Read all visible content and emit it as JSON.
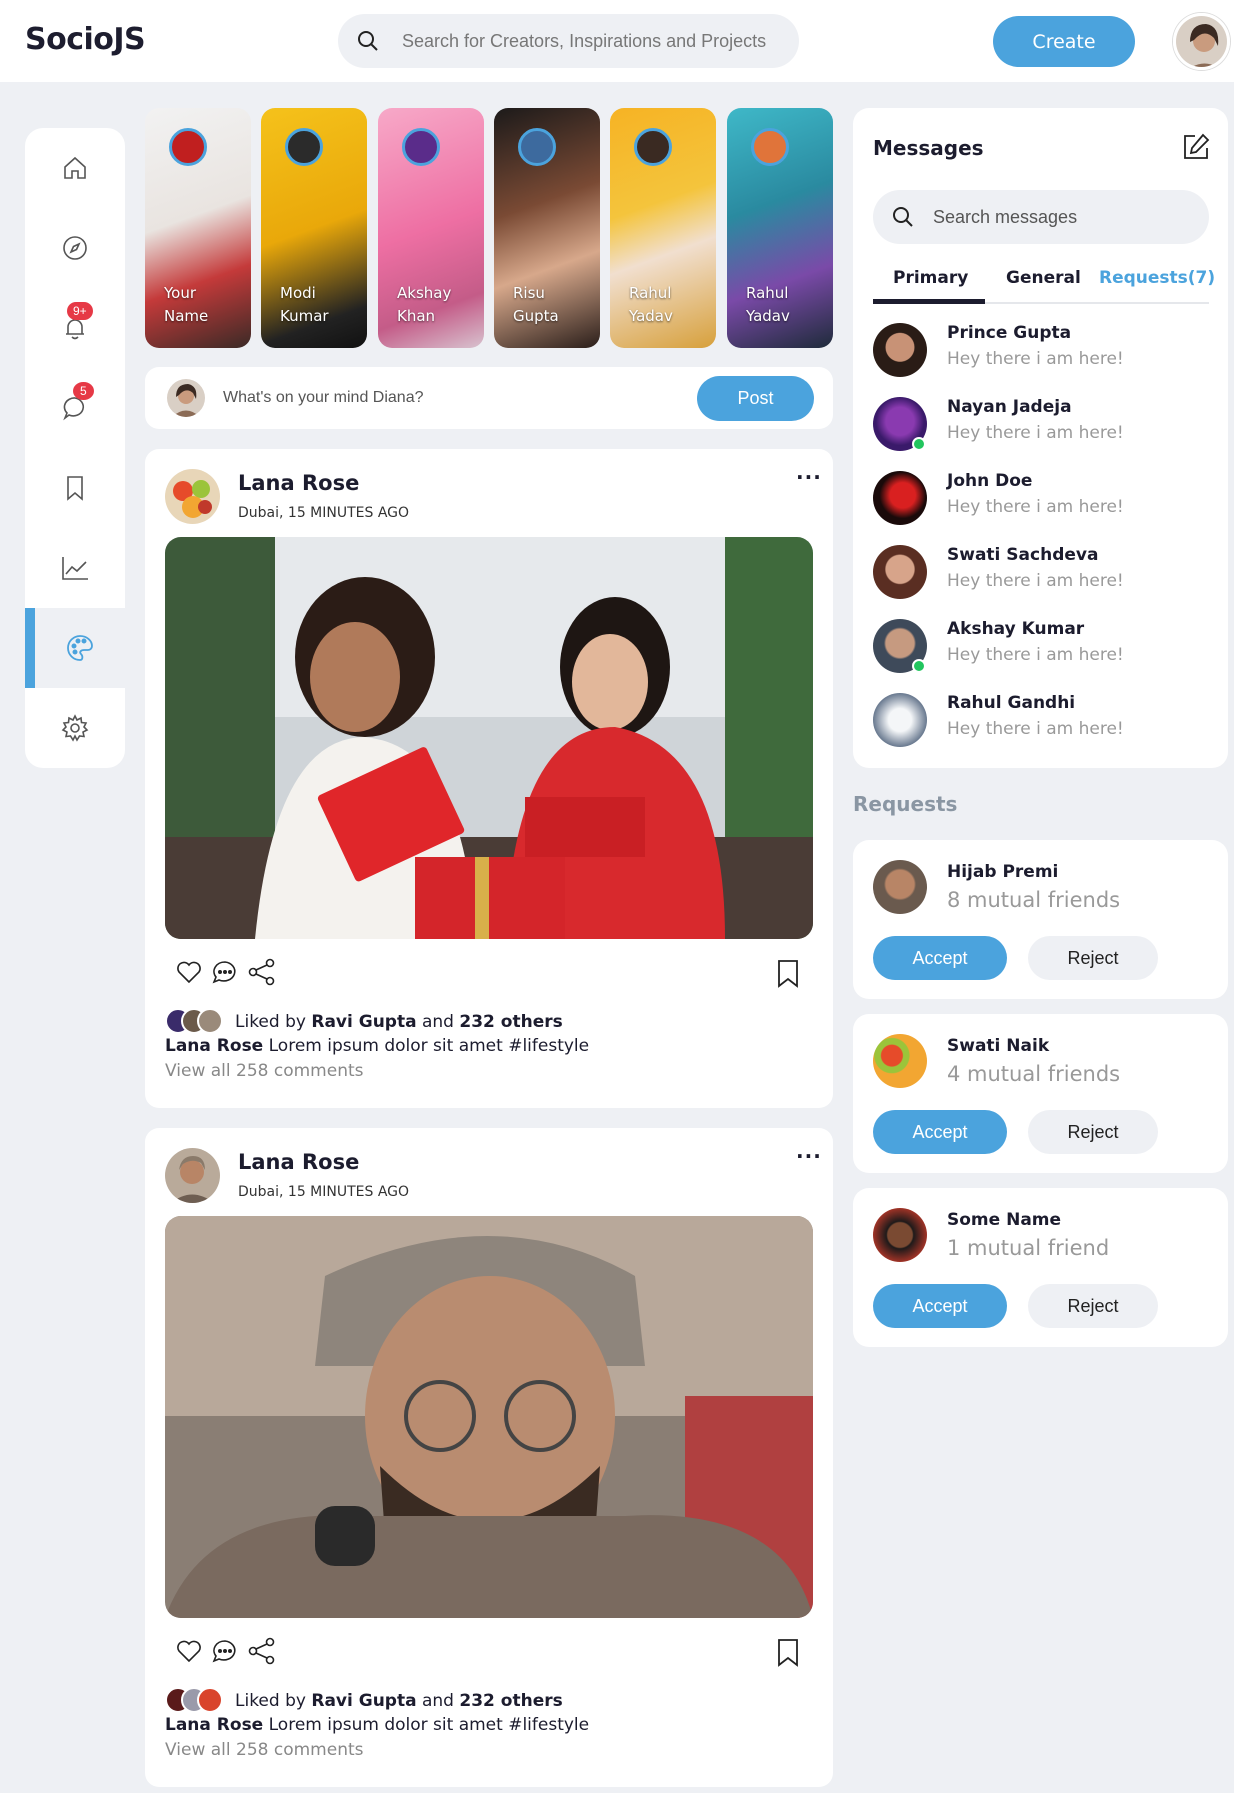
{
  "app": {
    "logo": "SocioJS"
  },
  "header": {
    "search_placeholder": "Search for Creators, Inspirations and Projects",
    "create_label": "Create"
  },
  "sidebar": {
    "items": [
      {
        "icon": "home-icon"
      },
      {
        "icon": "explore-icon"
      },
      {
        "icon": "notifications-icon",
        "badge": "9+"
      },
      {
        "icon": "messages-icon",
        "badge": "5"
      },
      {
        "icon": "bookmarks-icon"
      },
      {
        "icon": "analytics-icon"
      },
      {
        "icon": "theme-icon",
        "active": true
      },
      {
        "icon": "settings-icon"
      }
    ]
  },
  "stories": [
    {
      "line1": "Your",
      "line2": "Name"
    },
    {
      "line1": "Modi",
      "line2": "Kumar"
    },
    {
      "line1": "Akshay",
      "line2": "Khan"
    },
    {
      "line1": "Risu",
      "line2": "Gupta"
    },
    {
      "line1": "Rahul",
      "line2": "Yadav"
    },
    {
      "line1": "Rahul",
      "line2": "Yadav"
    }
  ],
  "composer": {
    "placeholder": "What's on your mind Diana?",
    "post_label": "Post"
  },
  "posts": [
    {
      "author": "Lana Rose",
      "meta": "Dubai, 15 MINUTES AGO",
      "liked_prefix": "Liked by",
      "liked_user": "Ravi Gupta",
      "liked_and": "and",
      "liked_others": "232 others",
      "cap_author": "Lana Rose",
      "cap_text": "Lorem ipsum dolor sit amet #lifestyle",
      "comments": "View all 258 comments"
    },
    {
      "author": "Lana Rose",
      "meta": "Dubai, 15 MINUTES AGO",
      "liked_prefix": "Liked by",
      "liked_user": "Ravi Gupta",
      "liked_and": "and",
      "liked_others": "232 others",
      "cap_author": "Lana Rose",
      "cap_text": "Lorem ipsum dolor sit amet #lifestyle",
      "comments": "View all 258 comments"
    }
  ],
  "messages": {
    "title": "Messages",
    "search_placeholder": "Search messages",
    "tabs": [
      "Primary",
      "General",
      "Requests(7)"
    ],
    "list": [
      {
        "name": "Prince Gupta",
        "preview": "Hey there i am here!"
      },
      {
        "name": "Nayan Jadeja",
        "preview": "Hey there i am here!"
      },
      {
        "name": "John Doe",
        "preview": "Hey there i am here!"
      },
      {
        "name": "Swati Sachdeva",
        "preview": "Hey there i am here!"
      },
      {
        "name": "Akshay Kumar",
        "preview": "Hey there i am here!"
      },
      {
        "name": "Rahul Gandhi",
        "preview": "Hey there i am here!"
      }
    ]
  },
  "requests": {
    "title": "Requests",
    "items": [
      {
        "name": "Hijab Premi",
        "mutual": "8 mutual friends",
        "accept": "Accept",
        "reject": "Reject"
      },
      {
        "name": "Swati Naik",
        "mutual": "4 mutual friends",
        "accept": "Accept",
        "reject": "Reject"
      },
      {
        "name": "Some Name",
        "mutual": "1 mutual friend",
        "accept": "Accept",
        "reject": "Reject"
      }
    ]
  },
  "colors": {
    "accent": "#4ba3dd",
    "badge": "#e63946",
    "background": "#eef0f4",
    "online": "#22c55e"
  }
}
